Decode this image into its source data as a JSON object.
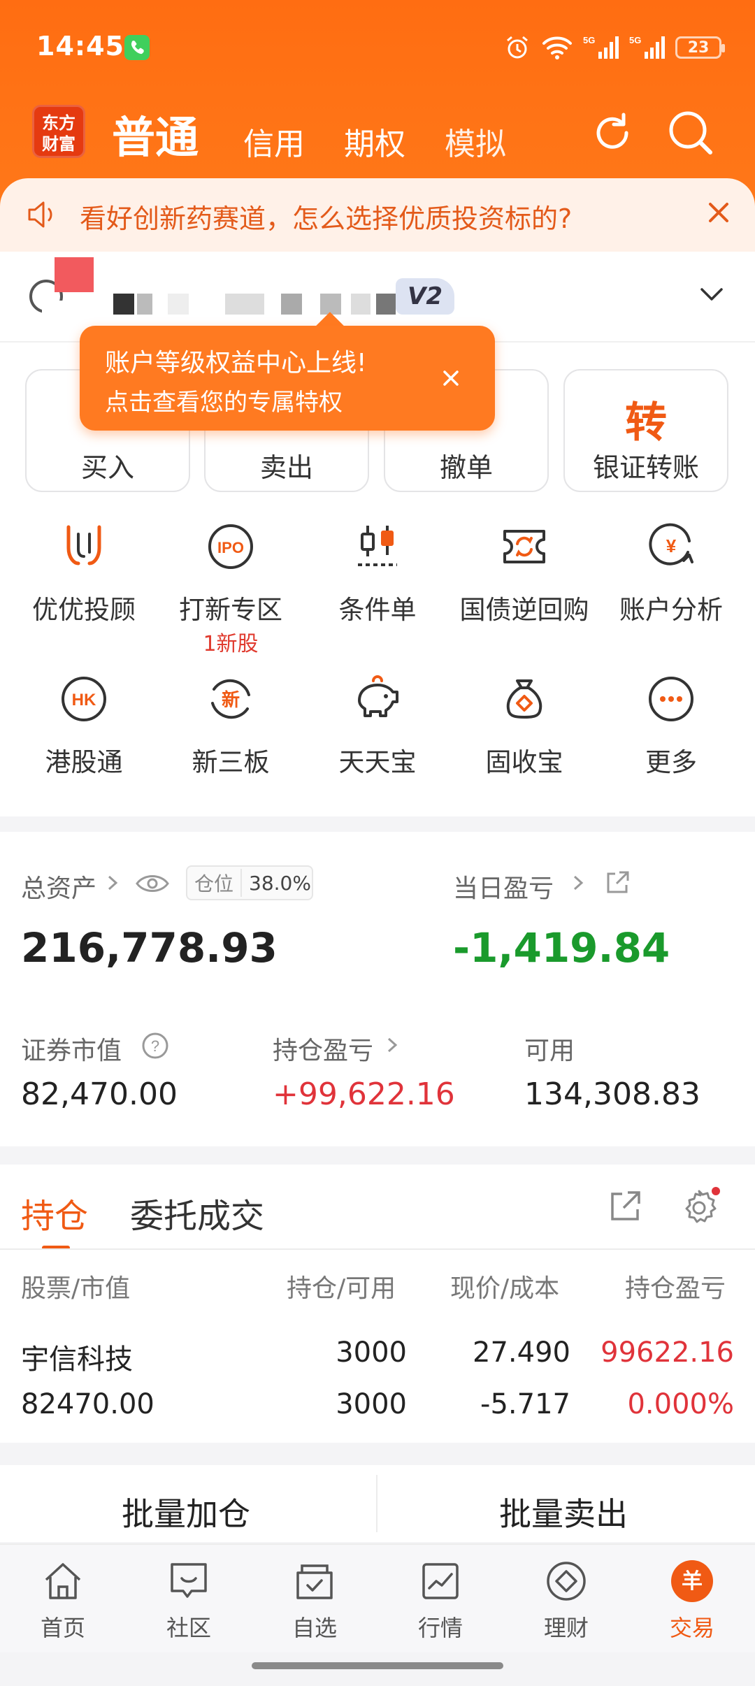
{
  "statusbar": {
    "time": "14:45",
    "battery": "23",
    "icons": [
      "phone-icon",
      "alarm-icon",
      "wifi-icon",
      "signal-5g-icon",
      "signal-5g-icon",
      "battery-icon"
    ]
  },
  "header": {
    "logo_line1": "东方",
    "logo_line2": "财富",
    "tabs": [
      "普通",
      "信用",
      "期权",
      "模拟"
    ],
    "active_tab": "普通"
  },
  "notice": {
    "text": "看好创新药赛道，怎么选择优质投资标的?"
  },
  "account": {
    "level_badge": "V2"
  },
  "tooltip": {
    "line1": "账户等级权益中心上线!",
    "line2": "点击查看您的专属特权"
  },
  "trade_buttons": [
    {
      "label": "买入"
    },
    {
      "label": "卖出"
    },
    {
      "label": "撤单"
    },
    {
      "label": "银证转账",
      "icon_text": "转"
    }
  ],
  "grid": [
    {
      "label": "优优投顾"
    },
    {
      "label": "打新专区",
      "sub": "1新股",
      "icon_text": "IPO"
    },
    {
      "label": "条件单"
    },
    {
      "label": "国债逆回购"
    },
    {
      "label": "账户分析",
      "icon_text": "¥"
    },
    {
      "label": "港股通",
      "icon_text": "HK"
    },
    {
      "label": "新三板",
      "icon_text": "新"
    },
    {
      "label": "天天宝"
    },
    {
      "label": "固收宝"
    },
    {
      "label": "更多",
      "icon_text": "···"
    }
  ],
  "assets": {
    "total_label": "总资产",
    "total_value": "216,778.93",
    "position_label": "仓位",
    "position_value": "38.0%",
    "daily_label": "当日盈亏",
    "daily_value": "-1,419.84",
    "market_label": "证券市值",
    "market_value": "82,470.00",
    "holding_pnl_label": "持仓盈亏",
    "holding_pnl_value": "+99,622.16",
    "available_label": "可用",
    "available_value": "134,308.83"
  },
  "holdings": {
    "tab_active": "持仓",
    "tab_inactive": "委托成交",
    "columns": [
      "股票/市值",
      "持仓/可用",
      "现价/成本",
      "持仓盈亏"
    ],
    "rows": [
      {
        "name": "宇信科技",
        "market_value": "82470.00",
        "position": "3000",
        "available": "3000",
        "price": "27.490",
        "cost": "-5.717",
        "pnl": "99622.16",
        "pnl_pct": "0.000%"
      }
    ]
  },
  "batch": {
    "add": "批量加仓",
    "sell": "批量卖出"
  },
  "bottom_nav": [
    {
      "label": "首页"
    },
    {
      "label": "社区"
    },
    {
      "label": "自选"
    },
    {
      "label": "行情"
    },
    {
      "label": "理财"
    },
    {
      "label": "交易",
      "icon_text": "羊"
    }
  ],
  "colors": {
    "brand": "#ff6d12",
    "accent": "#f05a14",
    "up": "#e0333a",
    "down": "#1a9a2c"
  }
}
